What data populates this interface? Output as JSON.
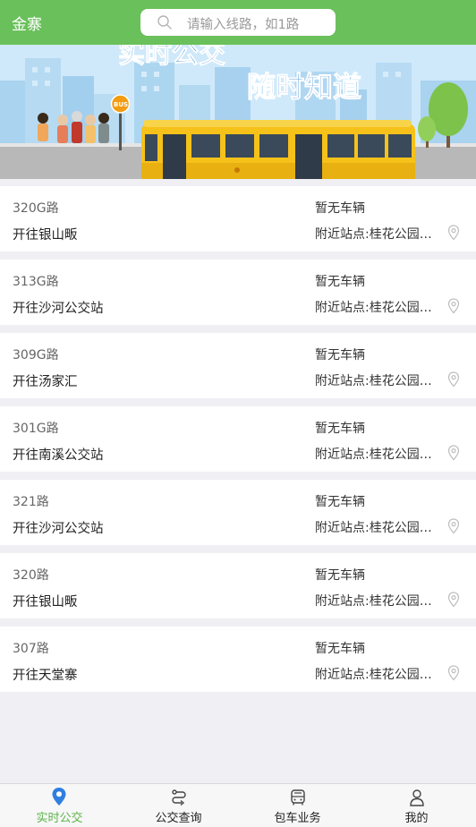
{
  "header": {
    "city": "金寨",
    "search_placeholder": "请输入线路，如1路"
  },
  "banner": {
    "headline_1": "实时公交",
    "headline_2": "随时知道",
    "sign_text": "BUS"
  },
  "routes": [
    {
      "route": "320G路",
      "destination": "开往银山畈",
      "status": "暂无车辆",
      "nearby": "附近站点:桂花公园北..."
    },
    {
      "route": "313G路",
      "destination": "开往沙河公交站",
      "status": "暂无车辆",
      "nearby": "附近站点:桂花公园北..."
    },
    {
      "route": "309G路",
      "destination": "开往汤家汇",
      "status": "暂无车辆",
      "nearby": "附近站点:桂花公园北..."
    },
    {
      "route": "301G路",
      "destination": "开往南溪公交站",
      "status": "暂无车辆",
      "nearby": "附近站点:桂花公园北..."
    },
    {
      "route": "321路",
      "destination": "开往沙河公交站",
      "status": "暂无车辆",
      "nearby": "附近站点:桂花公园北..."
    },
    {
      "route": "320路",
      "destination": "开往银山畈",
      "status": "暂无车辆",
      "nearby": "附近站点:桂花公园北..."
    },
    {
      "route": "307路",
      "destination": "开往天堂寨",
      "status": "暂无车辆",
      "nearby": "附近站点:桂花公园北..."
    }
  ],
  "tabs": [
    {
      "label": "实时公交",
      "icon": "location-pin-icon",
      "active": true
    },
    {
      "label": "公交查询",
      "icon": "route-icon",
      "active": false
    },
    {
      "label": "包车业务",
      "icon": "bus-icon",
      "active": false
    },
    {
      "label": "我的",
      "icon": "person-icon",
      "active": false
    }
  ],
  "colors": {
    "brand_green": "#6ac05b",
    "active_tab": "#5bb44a",
    "bus_yellow": "#f6c21a"
  }
}
